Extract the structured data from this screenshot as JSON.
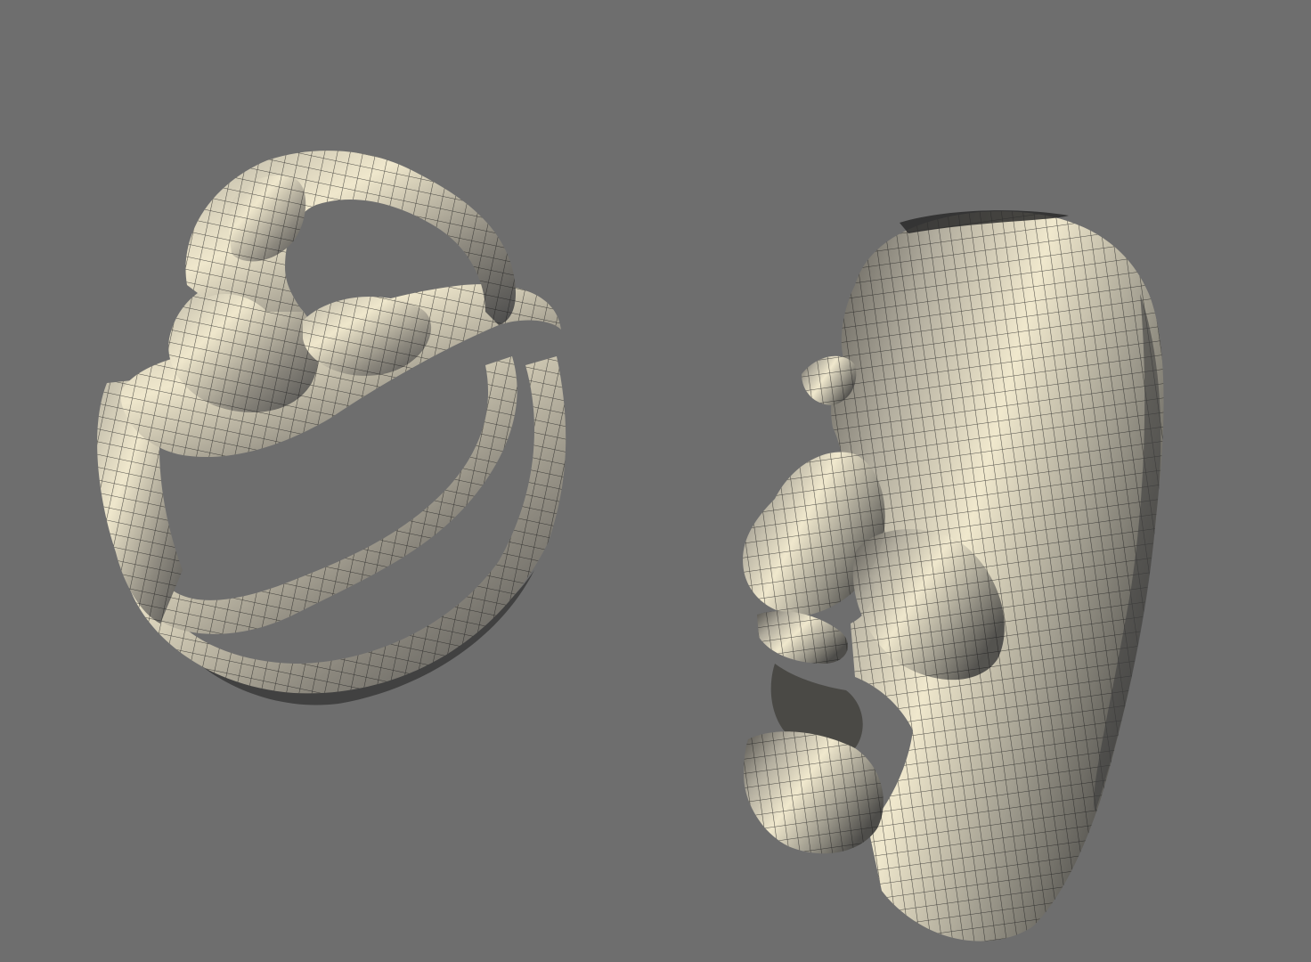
{
  "viewport": {
    "background_color": "#6e6e6e",
    "mesh_base_color": "#8c887e",
    "mesh_highlight_color": "#f3ecd2",
    "mesh_shadow_color": "#3a3a3a",
    "wire_color": "#1e1e1e"
  },
  "objects": [
    {
      "kind": "3d-mesh",
      "name": "mask-smile-wireframe"
    },
    {
      "kind": "3d-mesh",
      "name": "mask-profile-wireframe"
    }
  ]
}
